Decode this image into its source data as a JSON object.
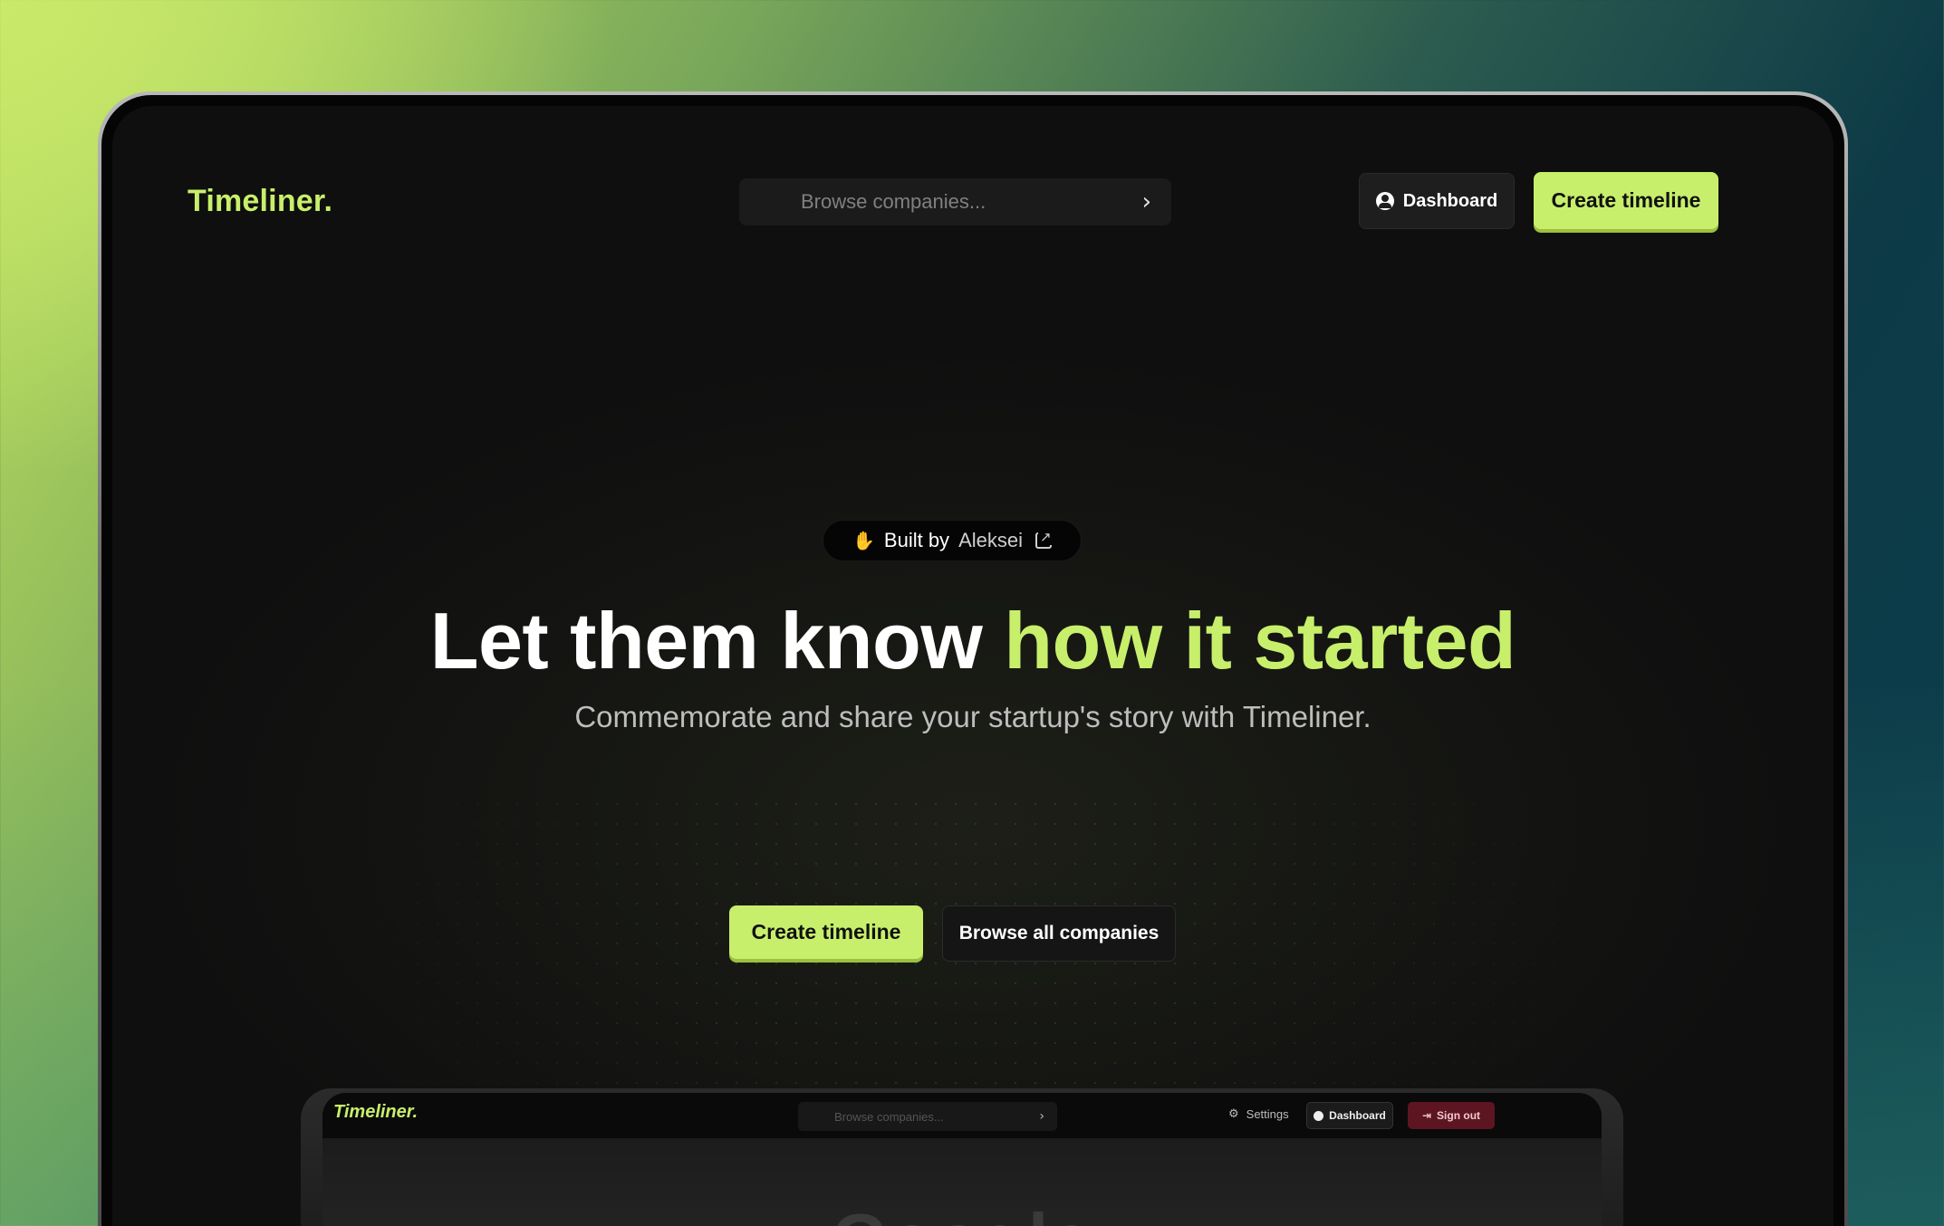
{
  "nav": {
    "logo": "Timeliner.",
    "search_placeholder": "Browse companies...",
    "dashboard_label": "Dashboard",
    "create_label": "Create timeline"
  },
  "hero": {
    "badge_prefix": "Built by",
    "badge_name": "Aleksei",
    "headline_main": "Let them know",
    "headline_accent": "how it started",
    "subhead": "Commemorate and share your startup's story with Timeliner.",
    "primary_cta": "Create timeline",
    "secondary_cta": "Browse all companies"
  },
  "preview": {
    "logo": "Timeliner.",
    "search_placeholder": "Browse companies...",
    "settings_label": "Settings",
    "dashboard_label": "Dashboard",
    "signout_label": "Sign out",
    "content_title": "Google"
  },
  "icons": {
    "badge_icon": "waving-hand-icon",
    "badge_link_icon": "external-link-icon",
    "search_icon": "chevron-right-icon",
    "dashboard_icon": "user-circle-icon",
    "settings_icon": "gear-icon",
    "signout_icon": "sign-out-icon"
  },
  "colors": {
    "accent": "#c8ef6b",
    "background": "#0f0f0f",
    "signout": "#5e1522"
  }
}
